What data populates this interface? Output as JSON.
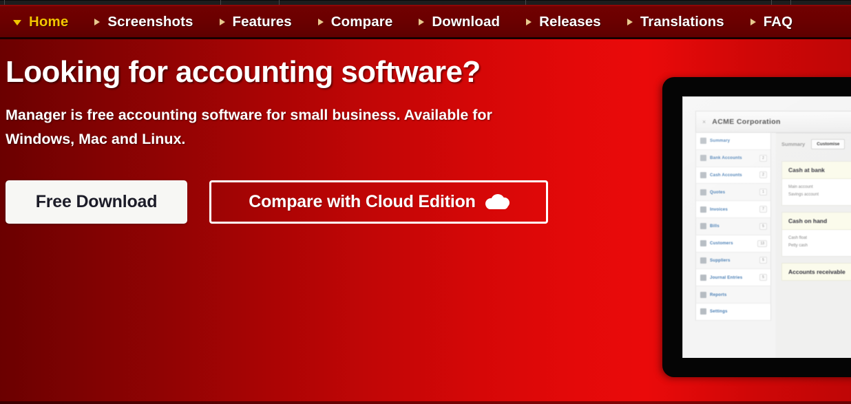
{
  "browser": {
    "tab_divider_positions": [
      6,
      320,
      405,
      763,
      1120,
      1148
    ]
  },
  "nav": {
    "items": [
      {
        "label": "Home",
        "arrow": "down",
        "active": true,
        "icon": "chevron-down-icon"
      },
      {
        "label": "Screenshots",
        "arrow": "right",
        "active": false,
        "icon": "chevron-right-icon"
      },
      {
        "label": "Features",
        "arrow": "right",
        "active": false,
        "icon": "chevron-right-icon"
      },
      {
        "label": "Compare",
        "arrow": "right",
        "active": false,
        "icon": "chevron-right-icon"
      },
      {
        "label": "Download",
        "arrow": "right",
        "active": false,
        "icon": "chevron-right-icon"
      },
      {
        "label": "Releases",
        "arrow": "right",
        "active": false,
        "icon": "chevron-right-icon"
      },
      {
        "label": "Translations",
        "arrow": "right",
        "active": false,
        "icon": "chevron-right-icon"
      },
      {
        "label": "FAQ",
        "arrow": "right",
        "active": false,
        "icon": "chevron-right-icon"
      }
    ]
  },
  "hero": {
    "title": "Looking for accounting software?",
    "subtitle": "Manager is free accounting software for small business. Available for Windows, Mac and Linux.",
    "primary_button": "Free Download",
    "outline_button": "Compare with Cloud Edition",
    "outline_button_icon": "cloud-icon"
  },
  "colors": {
    "nav_background": "#6b0000",
    "nav_active_text": "#f5c400",
    "nav_arrow": "#e8c98e",
    "hero_gradient_from": "#6b0000",
    "hero_gradient_to": "#ea0a0a",
    "primary_button_bg": "#f7f7f4",
    "primary_button_text": "#1c1c28",
    "text_on_hero": "#ffffff"
  },
  "device_mockup": {
    "app": {
      "close_glyph": "×",
      "company": "ACME Corporation",
      "sidebar": [
        {
          "label": "Summary",
          "badge": "",
          "icon": "monitor-icon"
        },
        {
          "label": "Bank Accounts",
          "badge": "2",
          "icon": "bank-icon"
        },
        {
          "label": "Cash Accounts",
          "badge": "2",
          "icon": "cash-icon"
        },
        {
          "label": "Quotes",
          "badge": "1",
          "icon": "quote-icon"
        },
        {
          "label": "Invoices",
          "badge": "7",
          "icon": "invoice-icon"
        },
        {
          "label": "Bills",
          "badge": "5",
          "icon": "bill-icon"
        },
        {
          "label": "Customers",
          "badge": "13",
          "icon": "customers-icon"
        },
        {
          "label": "Suppliers",
          "badge": "5",
          "icon": "suppliers-icon"
        },
        {
          "label": "Journal Entries",
          "badge": "5",
          "icon": "journal-icon"
        },
        {
          "label": "Reports",
          "badge": "",
          "icon": "reports-icon"
        },
        {
          "label": "Settings",
          "badge": "",
          "icon": "gear-icon"
        }
      ],
      "main": {
        "tab": "Summary",
        "customise_button": "Customise",
        "cards": [
          {
            "title": "Cash at bank",
            "rows": [
              "Main account",
              "Savings account"
            ]
          },
          {
            "title": "Cash on hand",
            "rows": [
              "Cash float",
              "Petty cash"
            ]
          },
          {
            "title": "Accounts receivable",
            "rows": []
          }
        ]
      }
    }
  }
}
